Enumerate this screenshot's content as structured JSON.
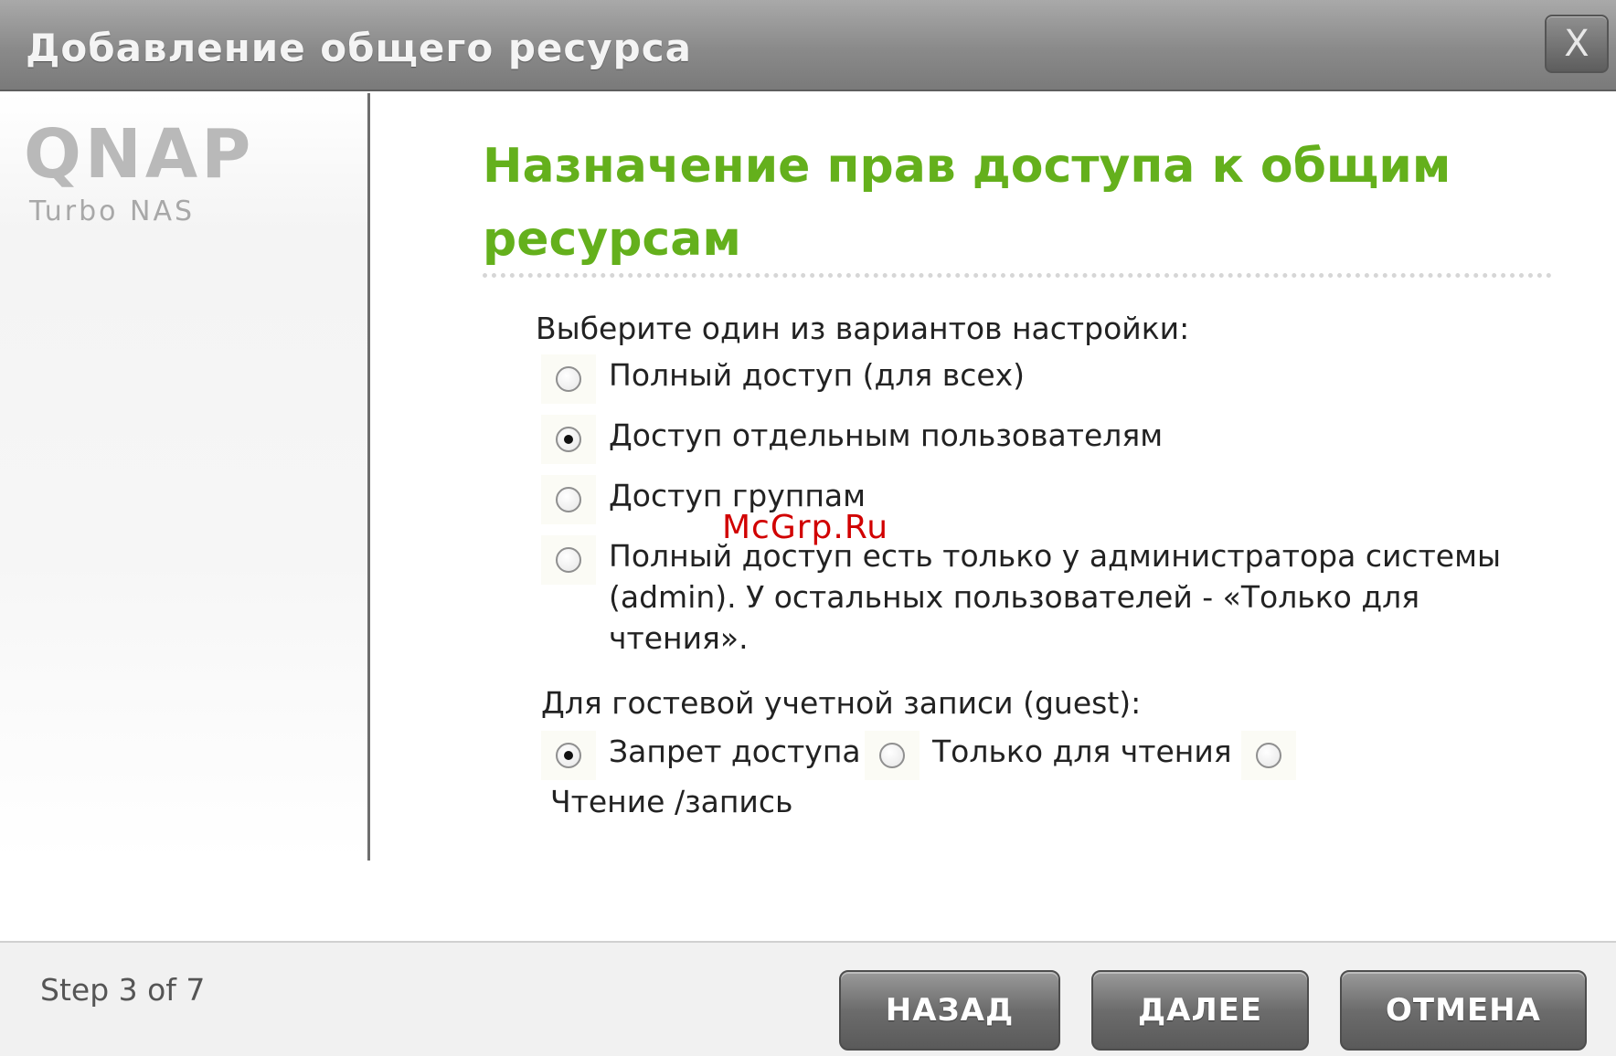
{
  "window": {
    "title": "Добавление общего ресурса",
    "close_label": "X"
  },
  "branding": {
    "logo_text": "QNAP",
    "logo_subtext": "Turbo NAS"
  },
  "main": {
    "heading": "Назначение прав доступа к общим ресурсам",
    "prompt": "Выберите один из вариантов настройки:",
    "options": [
      {
        "label": "Полный доступ (для всех)",
        "checked": false
      },
      {
        "label": "Доступ отдельным пользователям",
        "checked": true
      },
      {
        "label": "Доступ группам",
        "checked": false
      },
      {
        "label": "Полный доступ есть только у администратора системы (admin). У остальных пользователей - «Только для чтения».",
        "checked": false
      }
    ],
    "guest_title": "Для гостевой учетной записи (guest):",
    "guest_options": [
      {
        "label": "Запрет доступа",
        "checked": true
      },
      {
        "label": "Только для чтения",
        "checked": false
      },
      {
        "label": "Чтение /запись",
        "checked": false
      }
    ]
  },
  "watermark": "McGrp.Ru",
  "footer": {
    "step": "Step 3 of 7",
    "back_label": "НАЗАД",
    "next_label": "ДАЛЕЕ",
    "cancel_label": "ОТМЕНА"
  }
}
